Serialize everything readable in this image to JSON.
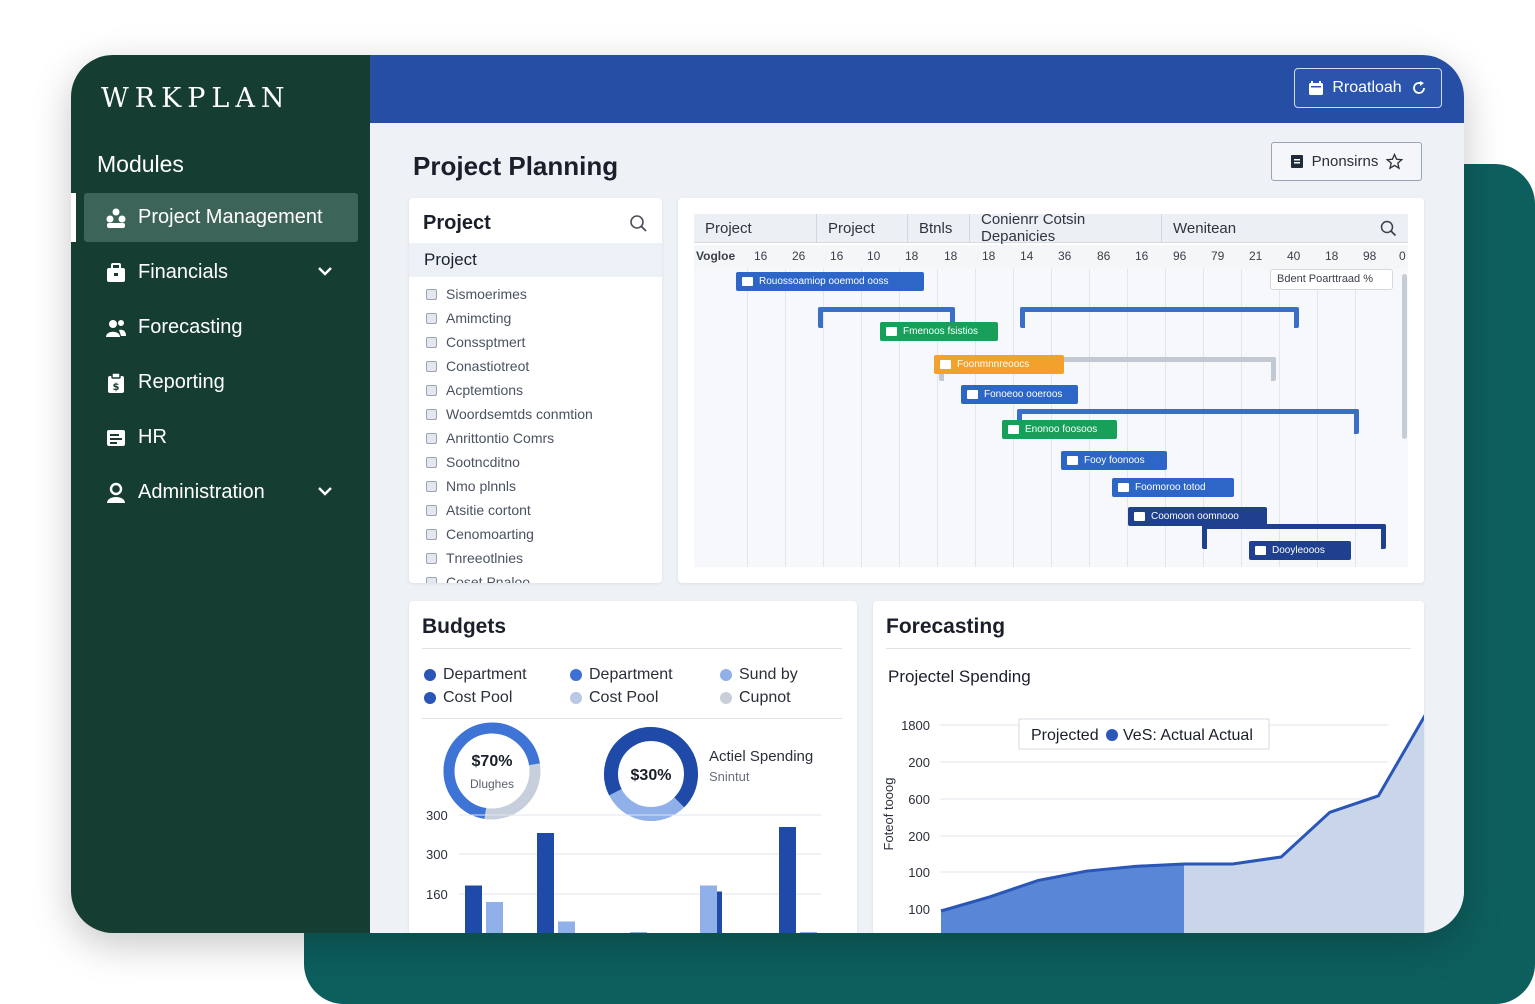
{
  "sidebar": {
    "logo": "WRKPLAN",
    "modules_heading": "Modules",
    "items": [
      {
        "label": "Project Management",
        "icon": "people-group-icon"
      },
      {
        "label": "Financials",
        "icon": "briefcase-icon"
      },
      {
        "label": "Forecasting",
        "icon": "users-icon"
      },
      {
        "label": "Reporting",
        "icon": "clipboard-icon"
      },
      {
        "label": "HR",
        "icon": "id-card-icon"
      },
      {
        "label": "Administration",
        "icon": "user-icon"
      }
    ]
  },
  "topbar": {
    "refresh_label": "Rroatloah"
  },
  "page": {
    "title": "Project Planning",
    "prefs_label": "Pnonsirns"
  },
  "project_panel": {
    "title": "Project",
    "selected": "Project",
    "items": [
      "Sismoerimes",
      "Amimcting",
      "Conssptmert",
      "Conastiotreot",
      "Acptemtions",
      "Woordsemtds conmtion",
      "Anrittontio Comrs",
      "Sootncditno",
      "Nmo plnnls",
      "Atsitie cortont",
      "Cenomoarting",
      "Tnreeotlnies",
      "Coset Pnaloo"
    ]
  },
  "gantt": {
    "headers": [
      "Project",
      "Project",
      "Btnls",
      "Conienrr Cotsin Depanicies",
      "Wenitean"
    ],
    "scale_label": "Vogloe",
    "scale": [
      "16",
      "26",
      "16",
      "10",
      "18",
      "18",
      "18",
      "14",
      "36",
      "86",
      "16",
      "96",
      "79",
      "21",
      "40",
      "18",
      "98",
      "0"
    ],
    "tooltip": "Bdent Poarttraad %",
    "bars": [
      {
        "label": "Rouossoamiop ooemod ooss",
        "color": "#2e66c8"
      },
      {
        "label": "Fmenoos fsistios",
        "color": "#18a05a"
      },
      {
        "label": "Foonmnnreoocs",
        "color": "#f1a12c"
      },
      {
        "label": "Fonoeoo ooeroos",
        "color": "#2e66c8"
      },
      {
        "label": "Enonoo foosoos",
        "color": "#18a05a"
      },
      {
        "label": "Fooy foonoos",
        "color": "#2e66c8"
      },
      {
        "label": "Foomoroo totod",
        "color": "#2e66c8"
      },
      {
        "label": "Coomoon oomnooo",
        "color": "#1f3f8f"
      },
      {
        "label": "Dooyleooos",
        "color": "#1f3f8f"
      }
    ]
  },
  "budgets": {
    "title": "Budgets",
    "legend": [
      {
        "label": "Department",
        "color": "#2a56b8"
      },
      {
        "label": "Department",
        "color": "#3d6fd4"
      },
      {
        "label": "Sund by",
        "color": "#8fb0e8"
      },
      {
        "label": "Cost Pool",
        "color": "#2a56b8"
      },
      {
        "label": "Cost Pool",
        "color": "#b9c8e4"
      },
      {
        "label": "Cupnot",
        "color": "#c9ced8"
      }
    ],
    "donut1": {
      "value_label": "$70%",
      "sub_label": "Dlughes",
      "fraction": 0.7
    },
    "donut2": {
      "value_label": "$30%",
      "fraction": 0.7
    },
    "donut2_side": {
      "title": "Actiel Spending",
      "sub": "Snintut"
    },
    "chart_data": {
      "type": "bar",
      "y_ticks": [
        "300",
        "300",
        "160"
      ],
      "series": [
        {
          "color": "#1f4aa8",
          "values": [
            185,
            360,
            0,
            0,
            165,
            380
          ]
        },
        {
          "color": "#8fb0e8",
          "values": [
            130,
            65,
            30,
            185,
            0,
            30
          ]
        }
      ]
    }
  },
  "forecasting": {
    "title": "Forecasting",
    "subtitle": "Projectel Spending",
    "legend_label": "Projected",
    "legend_label2": "VeS: Actual Actual",
    "ylabel": "Foteof tooog",
    "chart_data": {
      "type": "area",
      "y_ticks": [
        "1800",
        "200",
        "600",
        "200",
        "100",
        "100"
      ],
      "x": [
        0,
        1,
        2,
        3,
        4,
        5,
        6,
        7,
        8,
        9
      ],
      "actual": [
        100,
        160,
        230,
        270,
        290,
        300
      ],
      "projected": [
        300,
        330,
        520,
        590,
        820
      ]
    }
  }
}
